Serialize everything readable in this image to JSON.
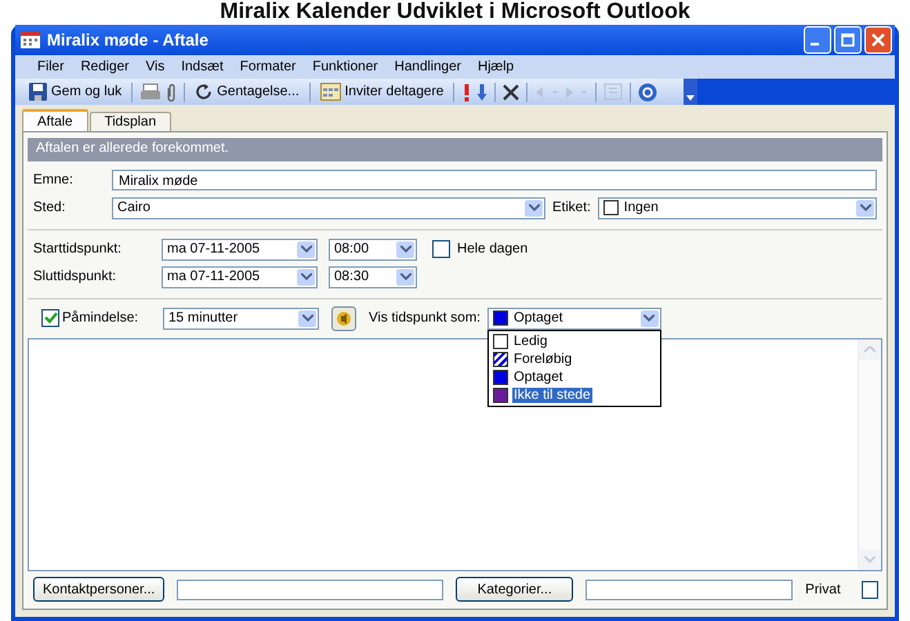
{
  "caption": "Miralix Kalender Udviklet i Microsoft Outlook",
  "window": {
    "title": "Miralix møde - Aftale"
  },
  "menu": [
    "Filer",
    "Rediger",
    "Vis",
    "Indsæt",
    "Formater",
    "Funktioner",
    "Handlinger",
    "Hjælp"
  ],
  "toolbar": {
    "save": "Gem og luk",
    "recurrence": "Gentagelse...",
    "invite": "Inviter deltagere"
  },
  "tabs": [
    {
      "label": "Aftale",
      "selected": true
    },
    {
      "label": "Tidsplan",
      "selected": false
    }
  ],
  "info_bar": "Aftalen er allerede forekommet.",
  "subject": {
    "label": "Emne:",
    "value": "Miralix møde"
  },
  "location": {
    "label": "Sted:",
    "value": "Cairo"
  },
  "label_field": {
    "label": "Etiket:",
    "value": "Ingen"
  },
  "start": {
    "label": "Starttidspunkt:",
    "date": "ma 07-11-2005",
    "time": "08:00"
  },
  "end": {
    "label": "Sluttidspunkt:",
    "date": "ma 07-11-2005",
    "time": "08:30"
  },
  "all_day": {
    "label": "Hele dagen",
    "checked": false
  },
  "reminder": {
    "label": "Påmindelse:",
    "checked": true,
    "value": "15 minutter"
  },
  "show_as": {
    "label": "Vis tidspunkt som:",
    "value": "Optaget",
    "color": "#0000e0",
    "options": [
      {
        "label": "Ledig",
        "kind": "empty",
        "color": "#ffffff",
        "highlighted": false
      },
      {
        "label": "Foreløbig",
        "kind": "hatched",
        "color": "#0000e0",
        "highlighted": false
      },
      {
        "label": "Optaget",
        "kind": "solid",
        "color": "#0000e0",
        "highlighted": false
      },
      {
        "label": "Ikke til stede",
        "kind": "solid",
        "color": "#6a1b9a",
        "highlighted": true
      }
    ]
  },
  "bottom": {
    "contacts": "Kontaktpersoner...",
    "categories": "Kategorier...",
    "private": {
      "label": "Privat",
      "checked": false
    }
  }
}
